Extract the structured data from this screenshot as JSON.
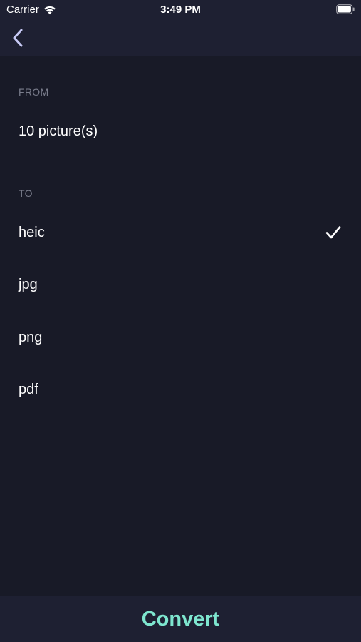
{
  "status_bar": {
    "carrier": "Carrier",
    "time": "3:49 PM",
    "wifi_icon": "wifi-icon",
    "battery_icon": "battery-icon"
  },
  "nav": {
    "back_icon": "chevron-left-icon"
  },
  "from_section": {
    "header": "FROM",
    "value": "10 picture(s)"
  },
  "to_section": {
    "header": "TO",
    "options": [
      {
        "label": "heic",
        "selected": true
      },
      {
        "label": "jpg",
        "selected": false
      },
      {
        "label": "png",
        "selected": false
      },
      {
        "label": "pdf",
        "selected": false
      }
    ]
  },
  "footer": {
    "convert_label": "Convert"
  },
  "colors": {
    "background": "#181a27",
    "bar": "#1e2032",
    "accent": "#7ee6cf",
    "muted_text": "#7a7d8c"
  }
}
